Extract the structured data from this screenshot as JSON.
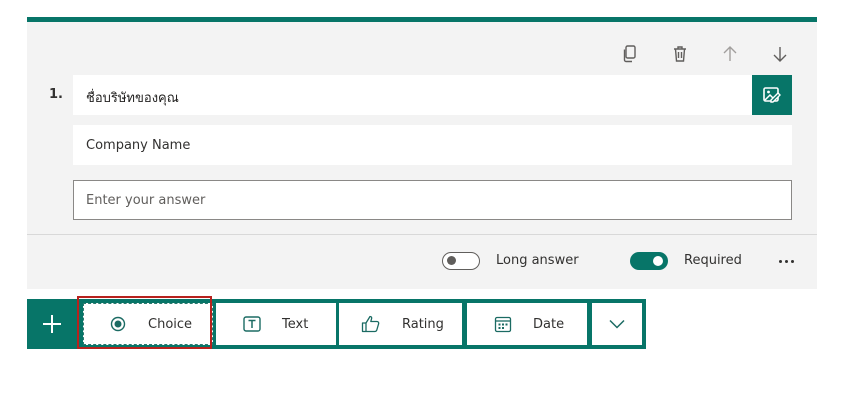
{
  "colors": {
    "accent": "#077568",
    "highlight": "#b7221e"
  },
  "question": {
    "number": "1.",
    "title": "ชื่อบริษัทของคุณ",
    "subtitle": "Company Name",
    "answer_placeholder": "Enter your answer"
  },
  "toolbar_icons": [
    "copy-icon",
    "delete-icon",
    "move-up-icon",
    "move-down-icon"
  ],
  "options": {
    "long_answer_label": "Long answer",
    "long_answer_on": false,
    "required_label": "Required",
    "required_on": true
  },
  "add_bar": {
    "items": [
      {
        "label": "Choice",
        "icon": "radio-choice-icon"
      },
      {
        "label": "Text",
        "icon": "text-box-icon"
      },
      {
        "label": "Rating",
        "icon": "thumbs-up-icon"
      },
      {
        "label": "Date",
        "icon": "calendar-icon"
      }
    ]
  }
}
